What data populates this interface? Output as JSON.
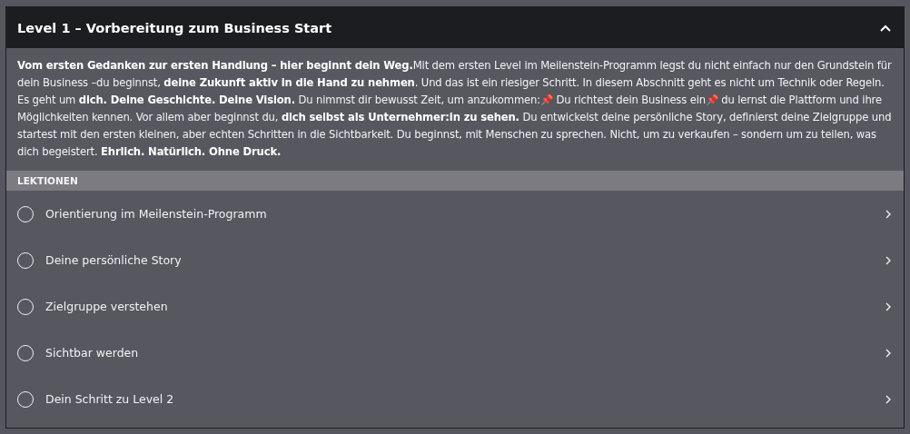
{
  "section": {
    "title": "Level 1 – Vorbereitung zum Business Start",
    "expanded": true,
    "description": "**Vom ersten Gedanken zur ersten Handlung – hier beginnt dein Weg.**Mit dem ersten Level im Meilenstein-Programm legst du nicht einfach nur den Grundstein für dein Business –du beginnst, **deine Zukunft aktiv in die Hand zu nehmen**. Und das ist ein riesiger Schritt. In diesem Abschnitt geht es nicht um Technik oder Regeln. Es geht um **dich. Deine Geschichte. Deine Vision.** Du nimmst dir bewusst Zeit, um anzukommen:📌 Du richtest dein Business ein📌 du lernst die Plattform und ihre Möglichkeiten kennen. Vor allem aber beginnst du, **dich selbst als Unternehmer:in zu sehen.** Du entwickelst deine persönliche Story, definierst deine Zielgruppe und startest mit den ersten kleinen, aber echten Schritten in die Sichtbarkeit. Du beginnst, mit Menschen zu sprechen. Nicht, um zu verkaufen – sondern um zu teilen, was dich begeistert. **Ehrlich. Natürlich. Ohne Druck.**",
    "lessons_heading": "LEKTIONEN",
    "lessons": [
      {
        "title": "Orientierung im Meilenstein-Programm",
        "completed": false
      },
      {
        "title": "Deine persönliche Story",
        "completed": false
      },
      {
        "title": "Zielgruppe verstehen",
        "completed": false
      },
      {
        "title": "Sichtbar werden",
        "completed": false
      },
      {
        "title": "Dein Schritt zu Level 2",
        "completed": false
      }
    ]
  }
}
